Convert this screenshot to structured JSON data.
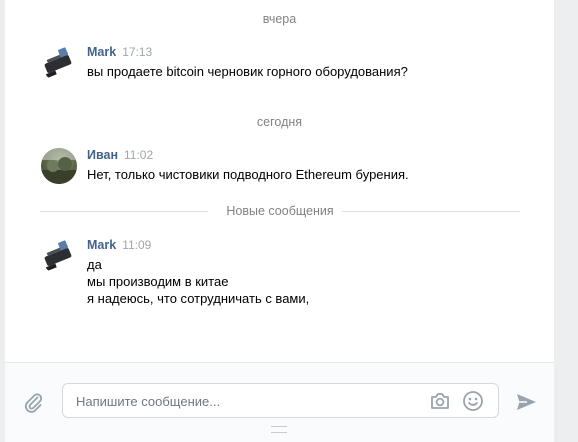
{
  "history": {
    "date_yesterday": "вчера",
    "date_today": "сегодня",
    "new_messages_label": "Новые сообщения"
  },
  "messages": [
    {
      "author": "Mark",
      "time": "17:13",
      "lines": [
        "вы продаете bitcoin черновик горного оборудования?"
      ]
    },
    {
      "author": "Иван",
      "time": "11:02",
      "lines": [
        "Нет, только чистовики подводного Ethereum бурения."
      ]
    },
    {
      "author": "Mark",
      "time": "11:09",
      "lines": [
        "да",
        "мы производим в китае",
        "я надеюсь, что сотрудничать с вами,"
      ]
    }
  ],
  "composer": {
    "placeholder": "Напишите сообщение..."
  },
  "icons": {
    "attach": "paperclip-icon",
    "camera": "camera-icon",
    "emoji": "smile-icon",
    "send": "send-icon"
  },
  "colors": {
    "author": "#42648b",
    "muted": "#828282",
    "accent_icon": "#99a2ad"
  }
}
